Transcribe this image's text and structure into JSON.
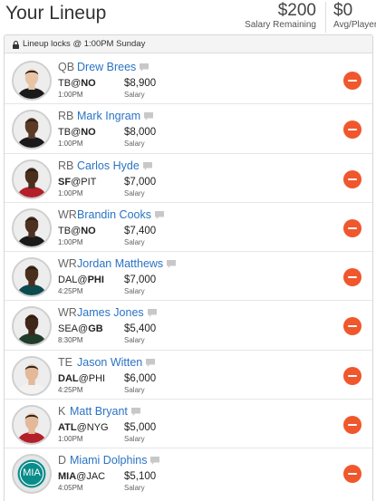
{
  "header": {
    "title": "Your Lineup",
    "salary_remaining_value": "$200",
    "salary_remaining_label": "Salary Remaining",
    "avg_player_value": "$0",
    "avg_player_label": "Avg/Player"
  },
  "lock_bar": {
    "text": "Lineup locks @ 1:00PM Sunday"
  },
  "players": [
    {
      "pos": "QB",
      "name": "Drew Brees",
      "team": "TB",
      "at": "@",
      "opp": "NO",
      "bold": "opp",
      "time": "1:00PM",
      "salary": "$8,900",
      "salary_label": "Salary",
      "jersey": "#1a1a1a",
      "skin": "#e8c4a6",
      "avatar": "player"
    },
    {
      "pos": "RB",
      "name": "Mark Ingram",
      "team": "TB",
      "at": "@",
      "opp": "NO",
      "bold": "opp",
      "time": "1:00PM",
      "salary": "$8,000",
      "salary_label": "Salary",
      "jersey": "#1a1a1a",
      "skin": "#5b3a26",
      "avatar": "player"
    },
    {
      "pos": "RB",
      "name": "Carlos Hyde",
      "team": "SF",
      "at": "@",
      "opp": "PIT",
      "bold": "team",
      "time": "1:00PM",
      "salary": "$7,000",
      "salary_label": "Salary",
      "jersey": "#b3202a",
      "skin": "#4a2e1e",
      "avatar": "player"
    },
    {
      "pos": "WR",
      "name": "Brandin Cooks",
      "team": "TB",
      "at": "@",
      "opp": "NO",
      "bold": "opp",
      "time": "1:00PM",
      "salary": "$7,400",
      "salary_label": "Salary",
      "jersey": "#1a1a1a",
      "skin": "#4e3020",
      "avatar": "player"
    },
    {
      "pos": "WR",
      "name": "Jordan Matthews",
      "team": "DAL",
      "at": "@",
      "opp": "PHI",
      "bold": "opp",
      "time": "4:25PM",
      "salary": "$7,000",
      "salary_label": "Salary",
      "jersey": "#0b4a4f",
      "skin": "#4a2e1e",
      "avatar": "player"
    },
    {
      "pos": "WR",
      "name": "James Jones",
      "team": "SEA",
      "at": "@",
      "opp": "GB",
      "bold": "opp",
      "time": "8:30PM",
      "salary": "$5,400",
      "salary_label": "Salary",
      "jersey": "#1f3d2a",
      "skin": "#3e2619",
      "avatar": "player"
    },
    {
      "pos": "TE",
      "name": "Jason Witten",
      "team": "DAL",
      "at": "@",
      "opp": "PHI",
      "bold": "team",
      "time": "4:25PM",
      "salary": "$6,000",
      "salary_label": "Salary",
      "jersey": "#f2f2f2",
      "skin": "#e3b99a",
      "avatar": "player"
    },
    {
      "pos": "K",
      "name": "Matt Bryant",
      "team": "ATL",
      "at": "@",
      "opp": "NYG",
      "bold": "team",
      "time": "1:00PM",
      "salary": "$5,000",
      "salary_label": "Salary",
      "jersey": "#b3202a",
      "skin": "#e3b99a",
      "avatar": "player"
    },
    {
      "pos": "D",
      "name": "Miami Dolphins",
      "team": "MIA",
      "at": "@",
      "opp": "JAC",
      "bold": "team",
      "time": "4:05PM",
      "salary": "$5,100",
      "salary_label": "Salary",
      "logo_text": "MIA",
      "logo_color": "#0a8c8a",
      "avatar": "logo"
    }
  ],
  "icons": {
    "lock": "lock-icon",
    "note": "note-icon",
    "remove": "minus-circle-icon"
  },
  "colors": {
    "link": "#2a73c4",
    "remove": "#f0572d"
  }
}
